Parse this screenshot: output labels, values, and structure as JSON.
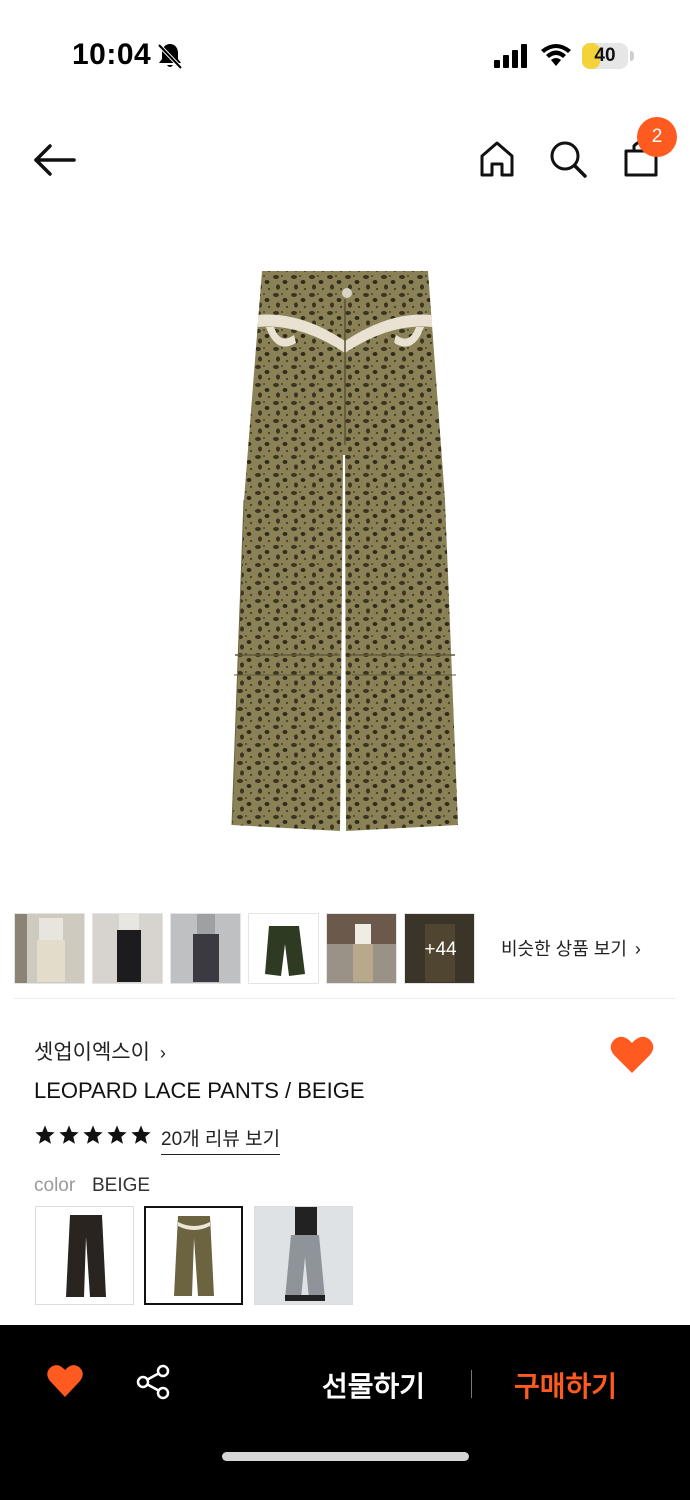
{
  "status_bar": {
    "time": "10:04",
    "battery": "40",
    "battery_level": 0.4,
    "icons": [
      "bell-slash-icon",
      "signal-icon",
      "wifi-icon",
      "battery-icon"
    ]
  },
  "header": {
    "icons": [
      "back-arrow-icon",
      "home-icon",
      "search-icon",
      "shopping-bag-icon"
    ],
    "cart_count": "2"
  },
  "gallery": {
    "more_count": "+44",
    "similar_link": "비슷한 상품 보기"
  },
  "product": {
    "brand": "셋업이엑스이",
    "title": "LEOPARD LACE PANTS / BEIGE",
    "rating": 5,
    "review_link": "20개 리뷰 보기",
    "color_label": "color",
    "color_value": "BEIGE"
  },
  "bottom_bar": {
    "gift_label": "선물하기",
    "buy_label": "구매하기"
  },
  "colors": {
    "accent": "#ff5a1f",
    "bar_background": "#000000"
  }
}
